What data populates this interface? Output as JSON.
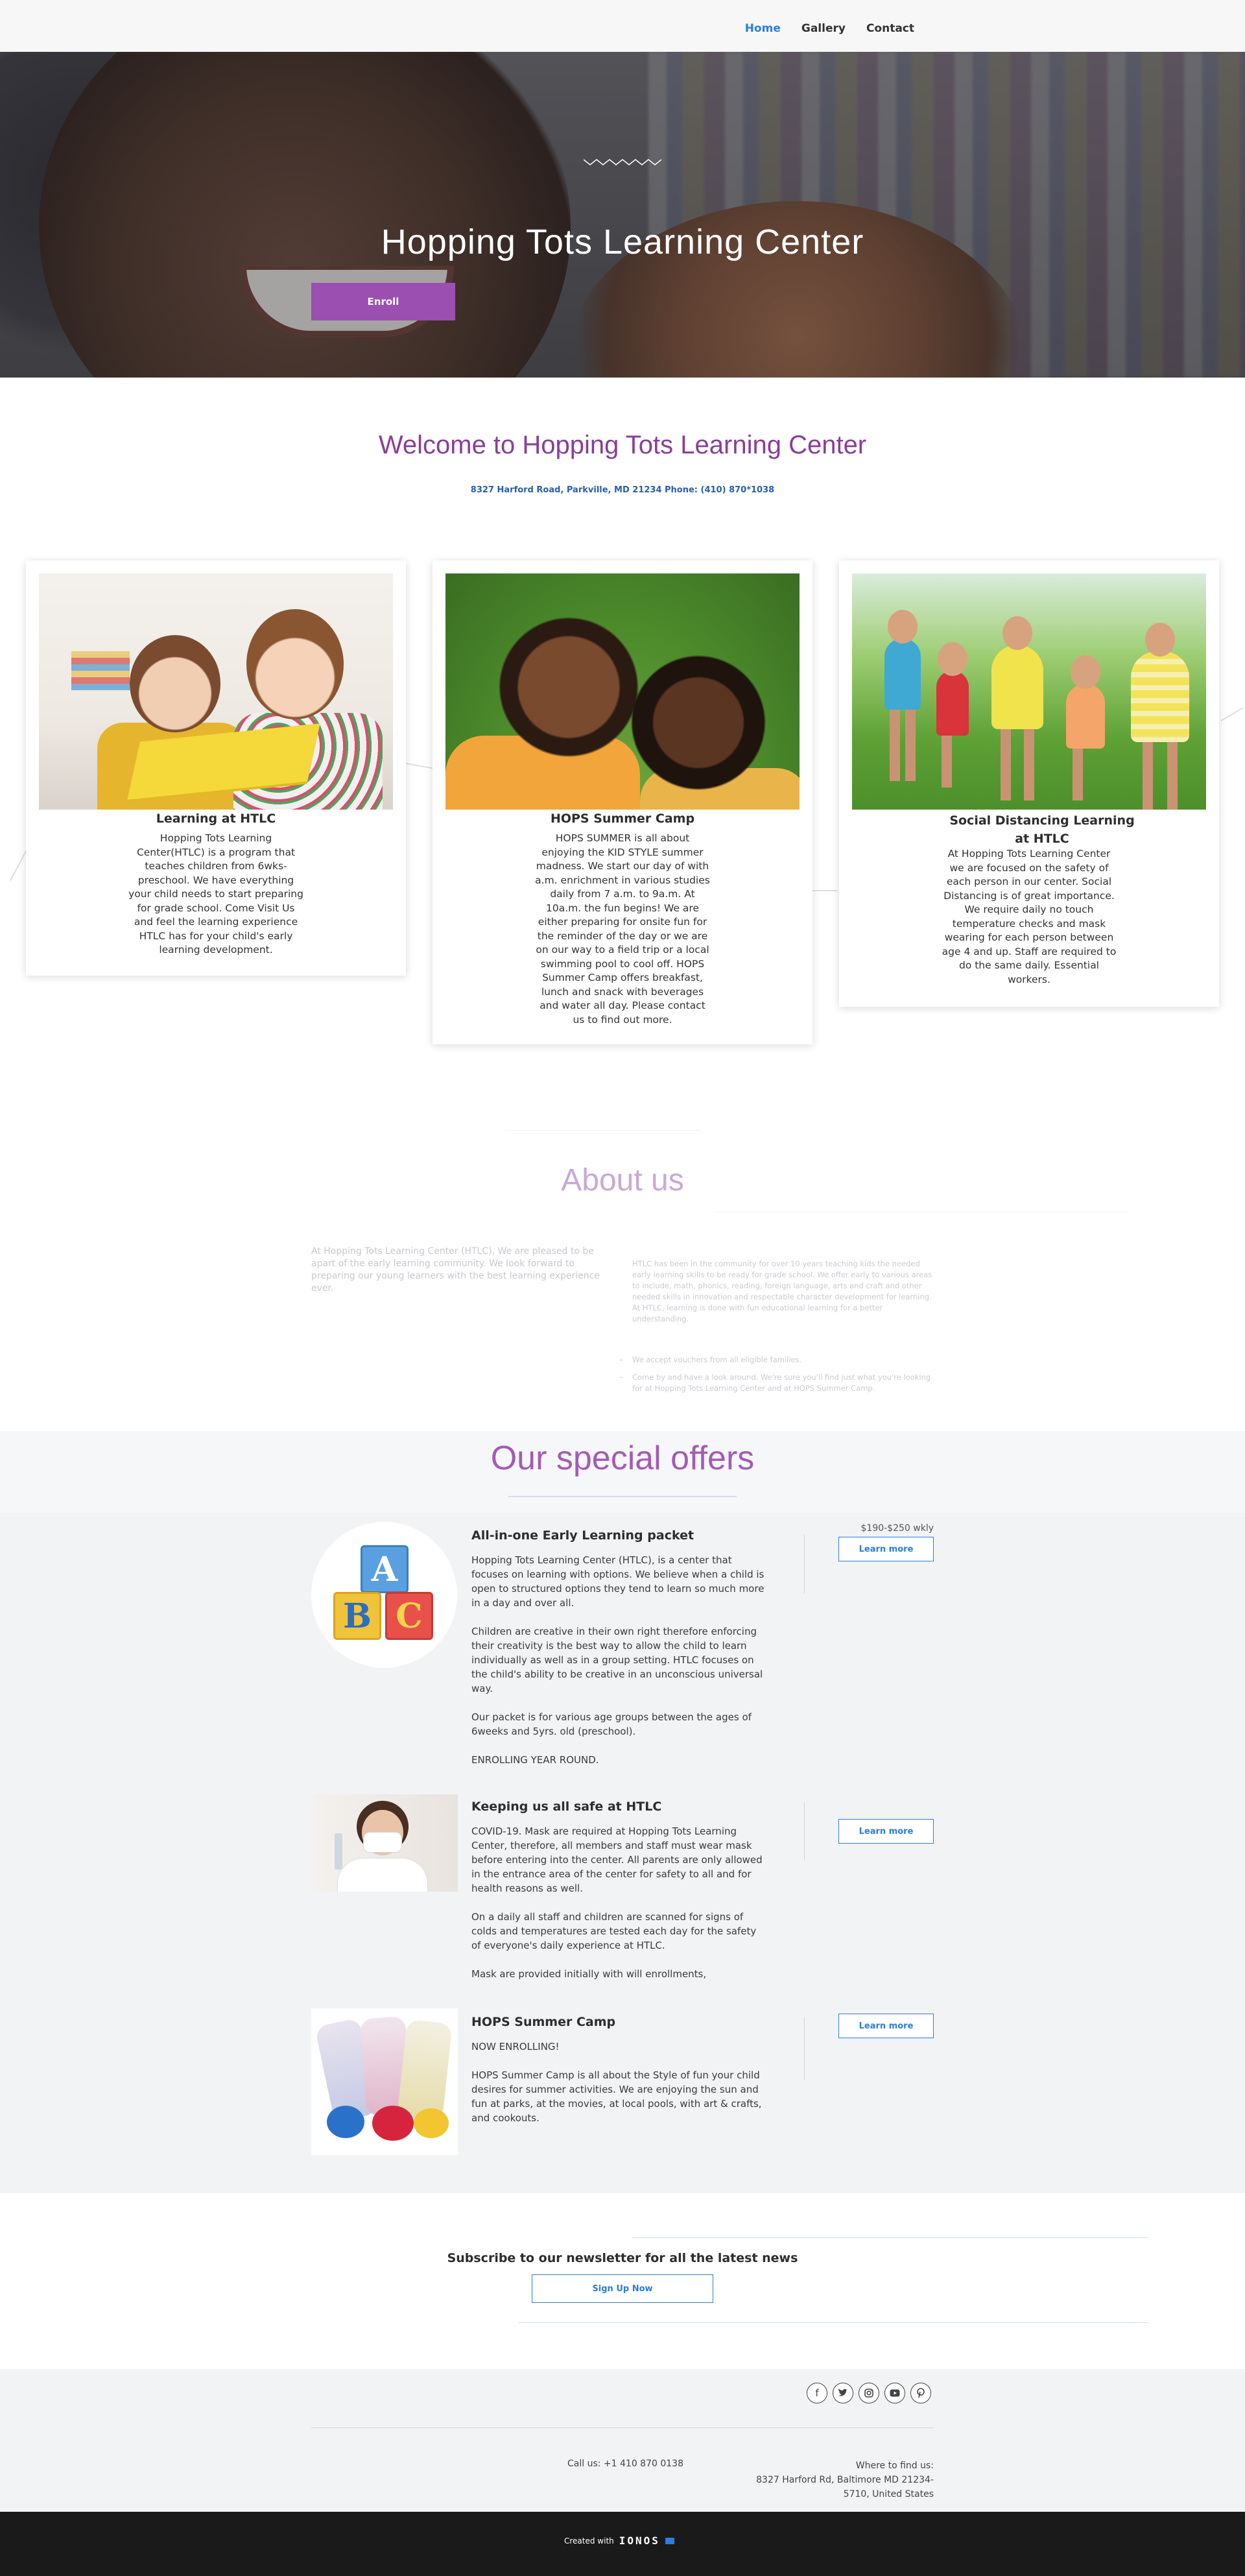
{
  "nav": {
    "items": [
      {
        "label": "Home",
        "active": true
      },
      {
        "label": "Gallery",
        "active": false
      },
      {
        "label": "Contact",
        "active": false
      }
    ]
  },
  "hero": {
    "title": "Hopping Tots Learning Center",
    "button": "Enroll"
  },
  "welcome": {
    "title": "Welcome to Hopping Tots Learning Center",
    "address": "8327 Harford Road, Parkville, MD 21234  Phone: (410) 870*1038"
  },
  "cards": [
    {
      "title": "Learning at HTLC",
      "text": "Hopping Tots Learning Center(HTLC) is a program that teaches children from 6wks-preschool. We have everything your child needs to start preparing for grade school. Come Visit Us and feel the learning experience HTLC has for your child's early learning development."
    },
    {
      "title": "HOPS Summer Camp",
      "text": "HOPS SUMMER is all about enjoying the KID STYLE summer madness.  We start our day of with a.m. enrichment in various studies daily from 7 a.m. to 9a.m.  At 10a.m. the fun begins! We are either preparing for onsite fun for the reminder of the day or we are on our way to a field trip or a local swimming pool to cool off.  HOPS Summer Camp offers breakfast, lunch and snack with beverages and water all day.  Please contact us to find out more."
    },
    {
      "title": "Social Distancing Learning at HTLC",
      "text": "At Hopping Tots Learning Center we are focused on the safety of each person in our center.  Social Distancing is of great importance.  We require daily no touch temperature checks and mask wearing for each person between age 4 and up.  Staff are required to do the same daily.  Essential workers."
    }
  ],
  "about": {
    "title": "About us",
    "left": "At Hopping Tots Learning Center (HTLC),  We are pleased to be apart of the early learning community.  We look forward to preparing our young learners with the best learning experience ever.",
    "right": "HTLC has been in the community for over 10 years teaching kids the needed early learning skills to be ready for grade school. We offer early to various areas to include, math, phonics, reading, foreign language, arts and craft and other needed skills in innovation and respectable character development for learning.  At HTLC, learning is done with fun educational learning for a better understanding.",
    "bullets": [
      "We accept vouchers from all eligible families.",
      "Come by and have a look around. We're sure you'll find just what you're looking for at Hopping Tots Learning Center and at HOPS Summer Camp."
    ]
  },
  "offers": {
    "title": "Our special offers",
    "items": [
      {
        "title": "All-in-one Early Learning packet",
        "paragraphs": [
          "Hopping Tots Learning Center (HTLC), is a center that focuses on learning with options.  We believe when a child is open to structured options they tend to learn so much more in a day and over all.",
          "Children are creative in their own right therefore enforcing their creativity is the best way to allow the child to learn individually as well as in a group setting.   HTLC focuses on the child's ability to be creative in an unconscious universal way.",
          "Our packet is for various age groups between the ages of 6weeks and 5yrs. old (preschool).",
          "ENROLLING YEAR ROUND."
        ],
        "price": "$190-$250 wkly",
        "button": "Learn more"
      },
      {
        "title": "Keeping us all safe at HTLC",
        "paragraphs": [
          "COVID-19.  Mask are required at Hopping Tots Learning Center, therefore, all members and staff must wear mask before entering into the center.  All parents are only allowed in the entrance area of the center for safety to all and for health reasons as well.",
          "On a daily all staff and children are scanned for signs of colds and temperatures are tested each day for the safety of everyone's daily experience at HTLC.",
          "Mask are provided initially with will enrollments,"
        ],
        "button": "Learn more"
      },
      {
        "title": "HOPS Summer Camp",
        "paragraphs": [
          "NOW ENROLLING!",
          "HOPS Summer Camp is all about the Style of fun your child desires for summer activities.  We are enjoying the sun and fun at parks, at the movies, at local pools, with art & crafts, and cookouts."
        ],
        "button": "Learn more"
      }
    ]
  },
  "newsletter": {
    "title": "Subscribe to our newsletter for all the latest news",
    "button": "Sign Up Now"
  },
  "footer": {
    "social_icons": [
      "facebook-icon",
      "twitter-icon",
      "instagram-icon",
      "youtube-icon",
      "pinterest-icon"
    ],
    "call": "Call us: +1 410 870 0138",
    "where_title": "Where to find us:",
    "where_line1": "8327 Harford Rd, Baltimore MD 21234-",
    "where_line2": "5710, United States",
    "created_with": "Created with",
    "brand": "IONOS"
  },
  "colors": {
    "accent_purple": "#9b4fb1",
    "title_purple": "#8a3d9c",
    "link_blue": "#2a7de1"
  }
}
